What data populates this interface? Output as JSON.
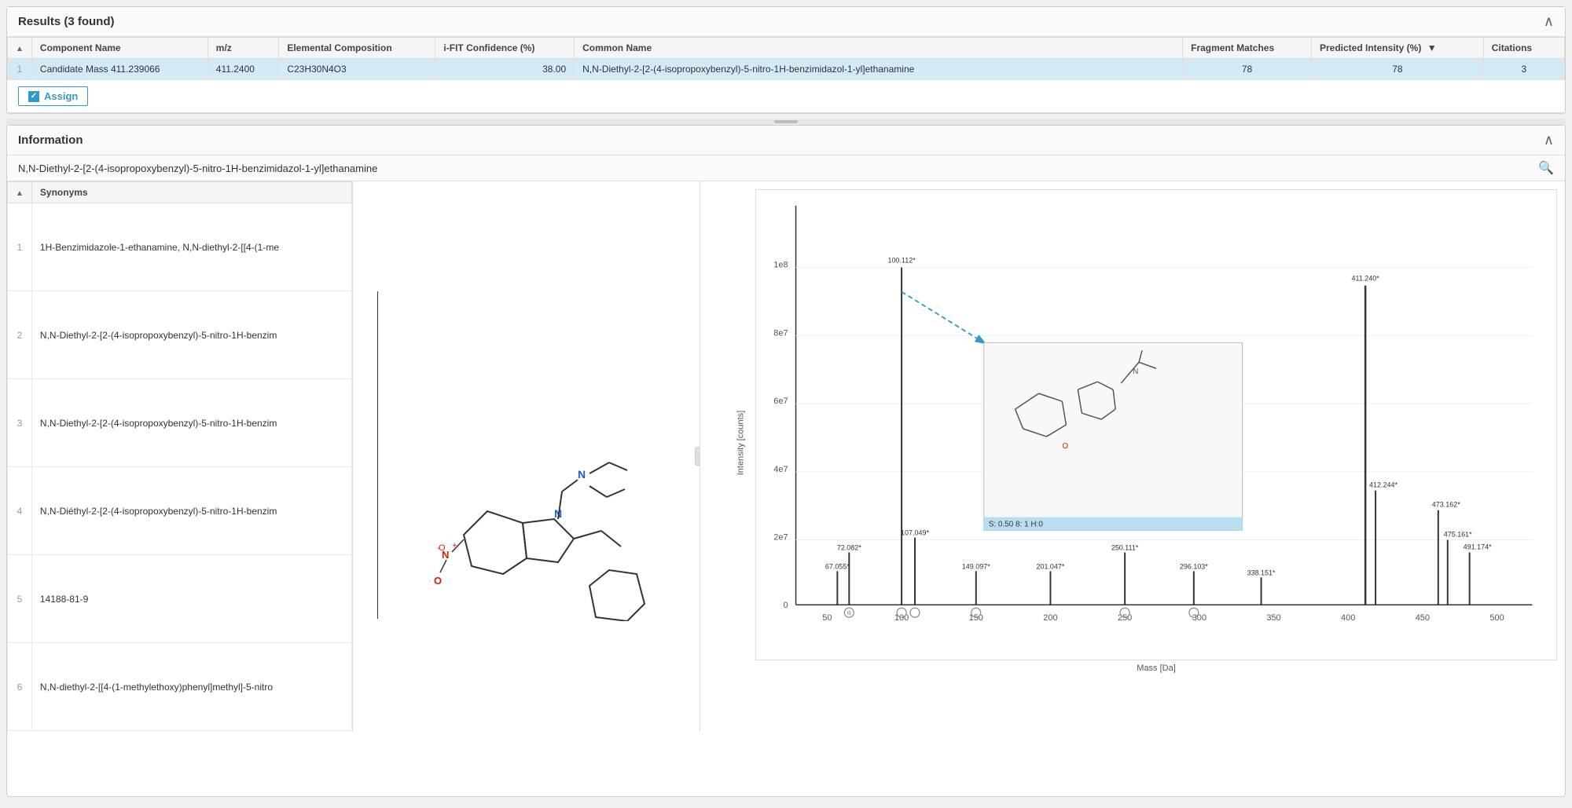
{
  "results_panel": {
    "title": "Results (3 found)",
    "collapse_icon": "∧",
    "columns": [
      {
        "id": "row_num",
        "label": ""
      },
      {
        "id": "component_name",
        "label": "Component Name"
      },
      {
        "id": "mz",
        "label": "m/z"
      },
      {
        "id": "elemental_composition",
        "label": "Elemental Composition"
      },
      {
        "id": "ifit_confidence",
        "label": "i-FIT Confidence (%)"
      },
      {
        "id": "common_name",
        "label": "Common Name"
      },
      {
        "id": "fragment_matches",
        "label": "Fragment Matches"
      },
      {
        "id": "predicted_intensity",
        "label": "Predicted Intensity (%)"
      },
      {
        "id": "citations",
        "label": "Citations"
      }
    ],
    "rows": [
      {
        "row_num": "1",
        "component_name": "Candidate Mass 411.239066",
        "mz": "411.2400",
        "elemental_composition": "C23H30N4O3",
        "ifit_confidence": "38.00",
        "common_name": "N,N-Diethyl-2-[2-(4-isopropoxybenzyl)-5-nitro-1H-benzimidazol-1-yl]ethanamine",
        "fragment_matches": "78",
        "predicted_intensity": "78",
        "citations": "3",
        "selected": true
      }
    ]
  },
  "assign_button": {
    "label": "Assign",
    "checkbox_checked": true
  },
  "information_panel": {
    "title": "Information",
    "collapse_icon": "∧",
    "compound_name": "N,N-Diethyl-2-[2-(4-isopropoxybenzyl)-5-nitro-1H-benzimidazol-1-yl]ethanamine",
    "search_icon": "🔍",
    "synonyms_header": "Synonyms",
    "synonyms": [
      {
        "num": "1",
        "name": "1H-Benzimidazole-1-ethanamine, N,N-diethyl-2-[[4-(1-me"
      },
      {
        "num": "2",
        "name": "N,N-Diethyl-2-[2-(4-isopropoxybenzyl)-5-nitro-1H-benzim"
      },
      {
        "num": "3",
        "name": "N,N-Diethyl-2-[2-(4-isopropoxybenzyl)-5-nitro-1H-benzim"
      },
      {
        "num": "4",
        "name": "N,N-Diéthyl-2-[2-(4-isopropoxybenzyl)-5-nitro-1H-benzim"
      },
      {
        "num": "5",
        "name": "14188-81-9"
      },
      {
        "num": "6",
        "name": "N,N-diethyl-2-[[4-(1-methylethoxy)phenyl]methyl]-5-nitro"
      }
    ]
  },
  "spectrum_panel": {
    "y_axis_label": "Intensity [counts]",
    "x_axis_label": "Mass [Da]",
    "peaks": [
      {
        "x": 67.055,
        "label": "67.055*",
        "rel_height": 0.08,
        "has_icon": false
      },
      {
        "x": 72.082,
        "label": "72.082*",
        "rel_height": 0.12,
        "has_icon": true
      },
      {
        "x": 100.112,
        "label": "100.112*",
        "rel_height": 1.0,
        "has_icon": true,
        "popup_arrow": true
      },
      {
        "x": 107.049,
        "label": "107.049*",
        "rel_height": 0.18,
        "has_icon": true
      },
      {
        "x": 149.097,
        "label": "149.097*",
        "rel_height": 0.08,
        "has_icon": true
      },
      {
        "x": 201.047,
        "label": "201.047*",
        "rel_height": 0.08,
        "has_icon": false
      },
      {
        "x": 250.111,
        "label": "250.111*",
        "rel_height": 0.12,
        "has_icon": true
      },
      {
        "x": 296.103,
        "label": "296.103*",
        "rel_height": 0.08,
        "has_icon": true
      },
      {
        "x": 338.151,
        "label": "338.151*",
        "rel_height": 0.06,
        "has_icon": false
      },
      {
        "x": 411.24,
        "label": "411.240*",
        "rel_height": 0.92,
        "has_icon": false
      },
      {
        "x": 412.244,
        "label": "412.244*",
        "rel_height": 0.28,
        "has_icon": false
      },
      {
        "x": 473.162,
        "label": "473.162*",
        "rel_height": 0.22,
        "has_icon": false
      },
      {
        "x": 475.161,
        "label": "475.161*",
        "rel_height": 0.15,
        "has_icon": false
      },
      {
        "x": 491.174,
        "label": "491.174*",
        "rel_height": 0.12,
        "has_icon": false
      }
    ],
    "y_ticks": [
      "0",
      "2e7",
      "4e7",
      "6e7",
      "8e7",
      "1e8"
    ],
    "x_ticks": [
      "50",
      "100",
      "150",
      "200",
      "250",
      "300",
      "350",
      "400",
      "450",
      "500"
    ],
    "popup": {
      "label": "S: 0.50 8: 1 H:0"
    }
  }
}
